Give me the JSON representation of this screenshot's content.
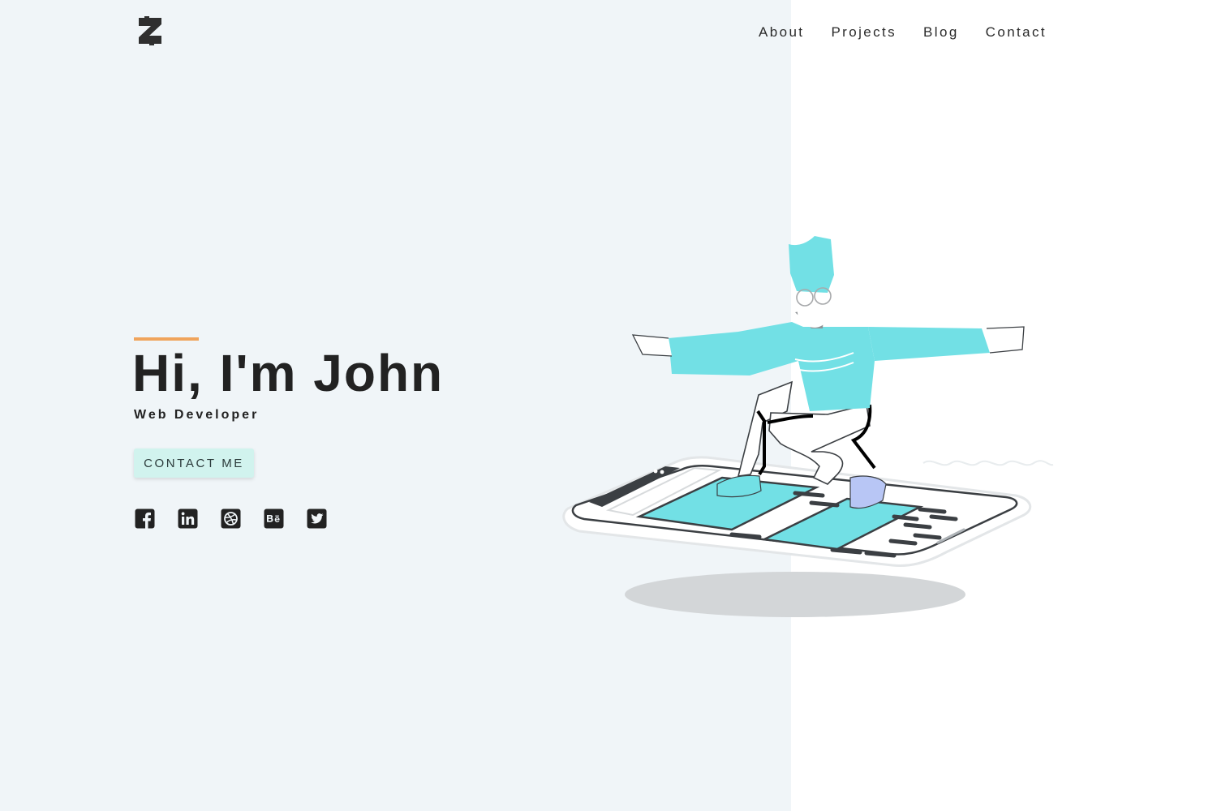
{
  "nav": {
    "items": [
      {
        "label": "About"
      },
      {
        "label": "Projects"
      },
      {
        "label": "Blog"
      },
      {
        "label": "Contact"
      }
    ]
  },
  "hero": {
    "title": "Hi, I'm John",
    "subtitle": "Web Developer",
    "cta_label": "CONTACT ME"
  },
  "socials": [
    {
      "icon": "facebook-icon"
    },
    {
      "icon": "linkedin-icon"
    },
    {
      "icon": "dribbble-icon"
    },
    {
      "icon": "behance-icon"
    },
    {
      "icon": "twitter-icon"
    }
  ],
  "colors": {
    "left_background": "#f0f5f8",
    "accent": "#f0a45c",
    "cta_background": "#d1f3ee",
    "illustration_teal": "#72e0e5",
    "text": "#222222"
  }
}
